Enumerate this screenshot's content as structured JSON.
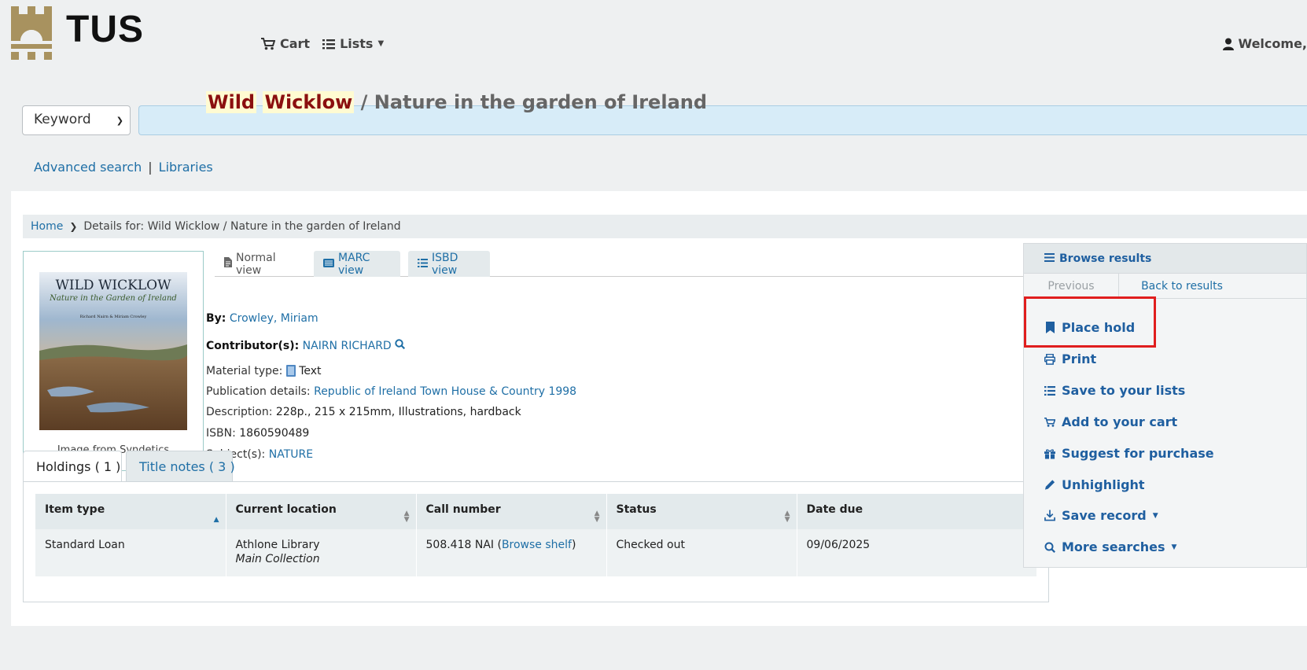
{
  "header": {
    "logo_text": "TUS",
    "cart_label": "Cart",
    "lists_label": "Lists",
    "welcome_text": "Welcome,"
  },
  "search": {
    "type_selected": "Keyword",
    "query": ""
  },
  "sublinks": {
    "advanced": "Advanced search",
    "separator": "|",
    "libraries": "Libraries"
  },
  "breadcrumb": {
    "home": "Home",
    "current": "Details for: Wild Wicklow / Nature in the garden of Ireland"
  },
  "cover": {
    "title": "WILD WICKLOW",
    "subtitle": "Nature in the Garden of Ireland",
    "authors": "Richard Nairn & Miriam Crowley",
    "caption": "Image from Syndetics"
  },
  "view_tabs": {
    "normal": "Normal view",
    "marc": "MARC view",
    "isbd": "ISBD view"
  },
  "record": {
    "title_highlight_1": "Wild",
    "title_highlight_2": "Wicklow",
    "title_rest": "/ Nature in the garden of Ireland",
    "by_label": "By:",
    "author": "Crowley, Miriam",
    "contributors_label": "Contributor(s):",
    "contributor": "NAIRN RICHARD",
    "material_label": "Material type:",
    "material": "Text",
    "publication_label": "Publication details:",
    "publication": "Republic of Ireland Town House & Country 1998",
    "description_label": "Description:",
    "description": "228p., 215 x 215mm, Illustrations, hardback",
    "isbn_label": "ISBN:",
    "isbn": "1860590489",
    "subjects_label": "Subject(s):",
    "subject": "NATURE"
  },
  "holdings_tabs": {
    "holdings": "Holdings ( 1 )",
    "notes": "Title notes ( 3 )"
  },
  "holdings_table": {
    "headers": [
      "Item type",
      "Current location",
      "Call number",
      "Status",
      "Date due"
    ],
    "row": {
      "item_type": "Standard Loan",
      "location": "Athlone Library",
      "collection": "Main Collection",
      "call_number": "508.418 NAI (",
      "browse_shelf": "Browse shelf",
      "call_close": ")",
      "status": "Checked out",
      "date_due": "09/06/2025"
    }
  },
  "sidebar": {
    "browse_results": "Browse results",
    "previous": "Previous",
    "back_to_results": "Back to results",
    "actions": {
      "place_hold": "Place hold",
      "print": "Print",
      "save_lists": "Save to your lists",
      "add_cart": "Add to your cart",
      "suggest": "Suggest for purchase",
      "unhighlight": "Unhighlight",
      "save_record": "Save record",
      "more_searches": "More searches"
    }
  },
  "colors": {
    "link": "#1f6fa6",
    "title_highlight": "#8b0f0f",
    "highlight_bg": "#fffbd2",
    "annotation_box": "#e01e1e",
    "search_input_bg": "#d7ecf8",
    "logo_gold": "#a8925f"
  }
}
